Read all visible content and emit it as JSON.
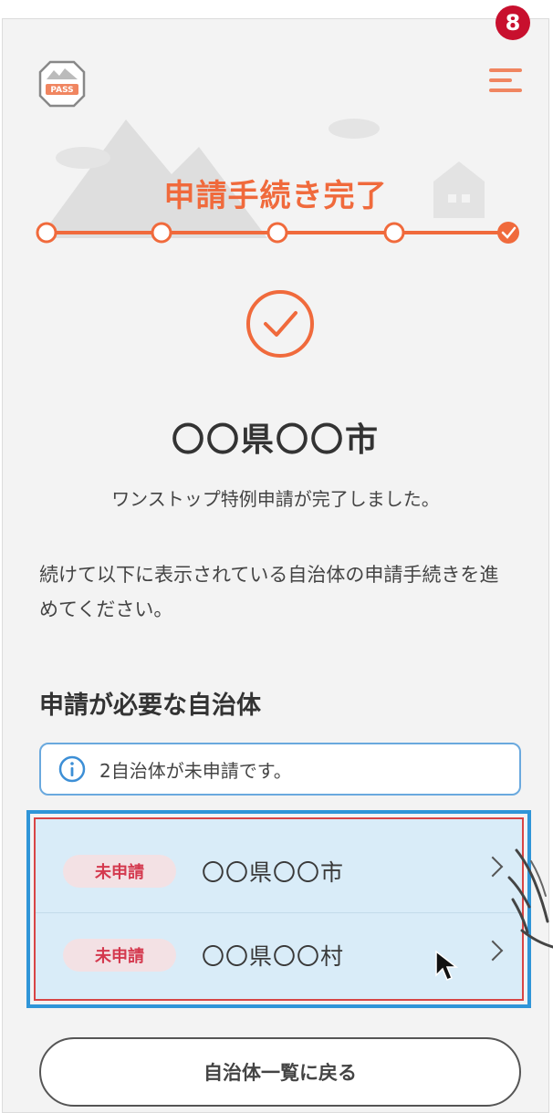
{
  "annotation": {
    "step_number": "8"
  },
  "header": {
    "logo_text": "PASS",
    "logo_icon": "furusato-pass-logo",
    "menu_icon": "hamburger-menu-icon"
  },
  "hero": {
    "title": "申請手続き完了"
  },
  "progress": {
    "total_steps": 5,
    "current_step": 5,
    "completed_icon": "check-icon"
  },
  "result": {
    "status_icon": "check-circle-icon",
    "municipality": "〇〇県〇〇市",
    "message": "ワンストップ特例申請が完了しました。",
    "instruction": "続けて以下に表示されている自治体の申請手続きを進めてください。"
  },
  "required": {
    "heading": "申請が必要な自治体",
    "notice": "2自治体が未申請です。",
    "notice_icon": "info-icon",
    "items": [
      {
        "status": "未申請",
        "name": "〇〇県〇〇市"
      },
      {
        "status": "未申請",
        "name": "〇〇県〇〇村"
      }
    ]
  },
  "footer": {
    "back_label": "自治体一覧に戻る"
  },
  "colors": {
    "accent": "#f06a3c",
    "info_border": "#6aa9de",
    "status_red": "#d4394e",
    "highlight_blue": "#2f95d8"
  }
}
